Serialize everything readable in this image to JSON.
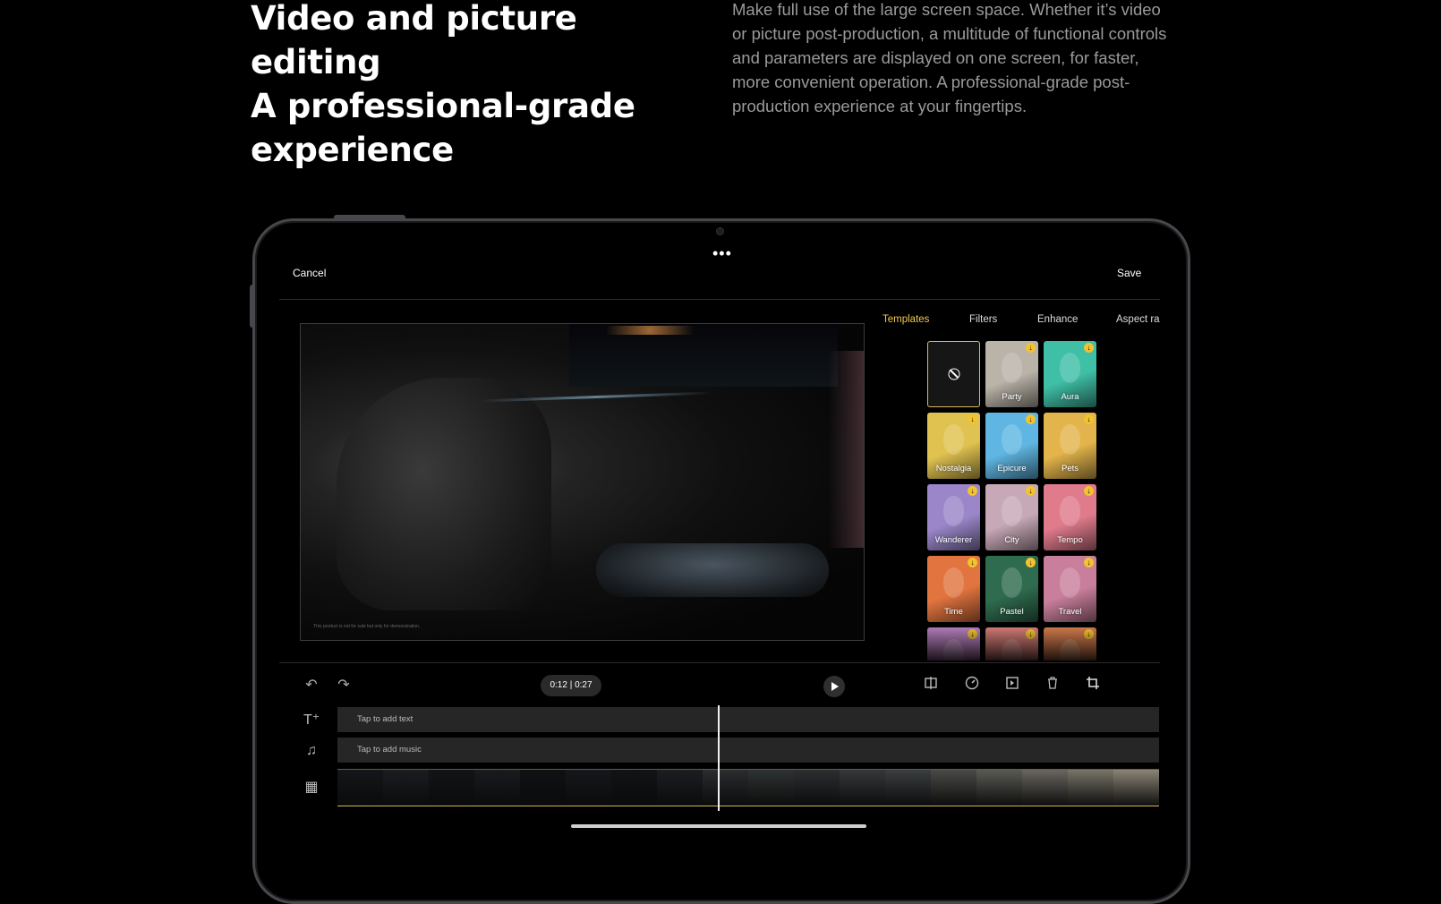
{
  "hero": {
    "heading_lines": [
      "Video and picture editing",
      "A professional-grade",
      "experience"
    ],
    "description": "Make full use of the large screen space. Whether it’s video or picture post-production, a multitude of functional controls and parameters are displayed on one screen, for faster, more convenient operation. A professional-grade post-production experience at your fingertips."
  },
  "editor": {
    "cancel_label": "Cancel",
    "save_label": "Save",
    "more_label": "•••",
    "disclaimer": "This product is not for sale but only for demonstration.",
    "tabs": [
      {
        "label": "Templates",
        "active": true
      },
      {
        "label": "Filters",
        "active": false
      },
      {
        "label": "Enhance",
        "active": false
      },
      {
        "label": "Aspect ra",
        "active": false
      }
    ],
    "templates": [
      {
        "label": "",
        "icon": "none-icon",
        "selected": true
      },
      {
        "label": "Party",
        "color": "#b9b3a8",
        "download": true
      },
      {
        "label": "Aura",
        "color": "#3fbfa6",
        "download": true
      },
      {
        "label": "Nostalgia",
        "color": "#e0c250",
        "download": true
      },
      {
        "label": "Epicure",
        "color": "#5fb6e2",
        "download": true
      },
      {
        "label": "Pets",
        "color": "#e2b44b",
        "download": true
      },
      {
        "label": "Wanderer",
        "color": "#9a86c9",
        "download": true
      },
      {
        "label": "City",
        "color": "#c7a8b6",
        "download": true
      },
      {
        "label": "Tempo",
        "color": "#e07b8c",
        "download": true
      },
      {
        "label": "Time",
        "color": "#e1743f",
        "download": true
      },
      {
        "label": "Pastel",
        "color": "#2f6b4e",
        "download": true
      },
      {
        "label": "Travel",
        "color": "#c97f9b",
        "download": true
      },
      {
        "label": "",
        "color": "#b27db9",
        "download": true
      },
      {
        "label": "",
        "color": "#d27a74",
        "download": true
      },
      {
        "label": "",
        "color": "#cf7a4c",
        "download": true
      }
    ],
    "toolbar": {
      "time_display": "0:12 | 0:27",
      "icons": [
        "undo-icon",
        "redo-icon",
        "play-icon",
        "split-icon",
        "speed-icon",
        "insert-icon",
        "delete-icon",
        "crop-icon"
      ]
    },
    "tracks": {
      "text_placeholder": "Tap to add text",
      "music_placeholder": "Tap to add music"
    }
  }
}
